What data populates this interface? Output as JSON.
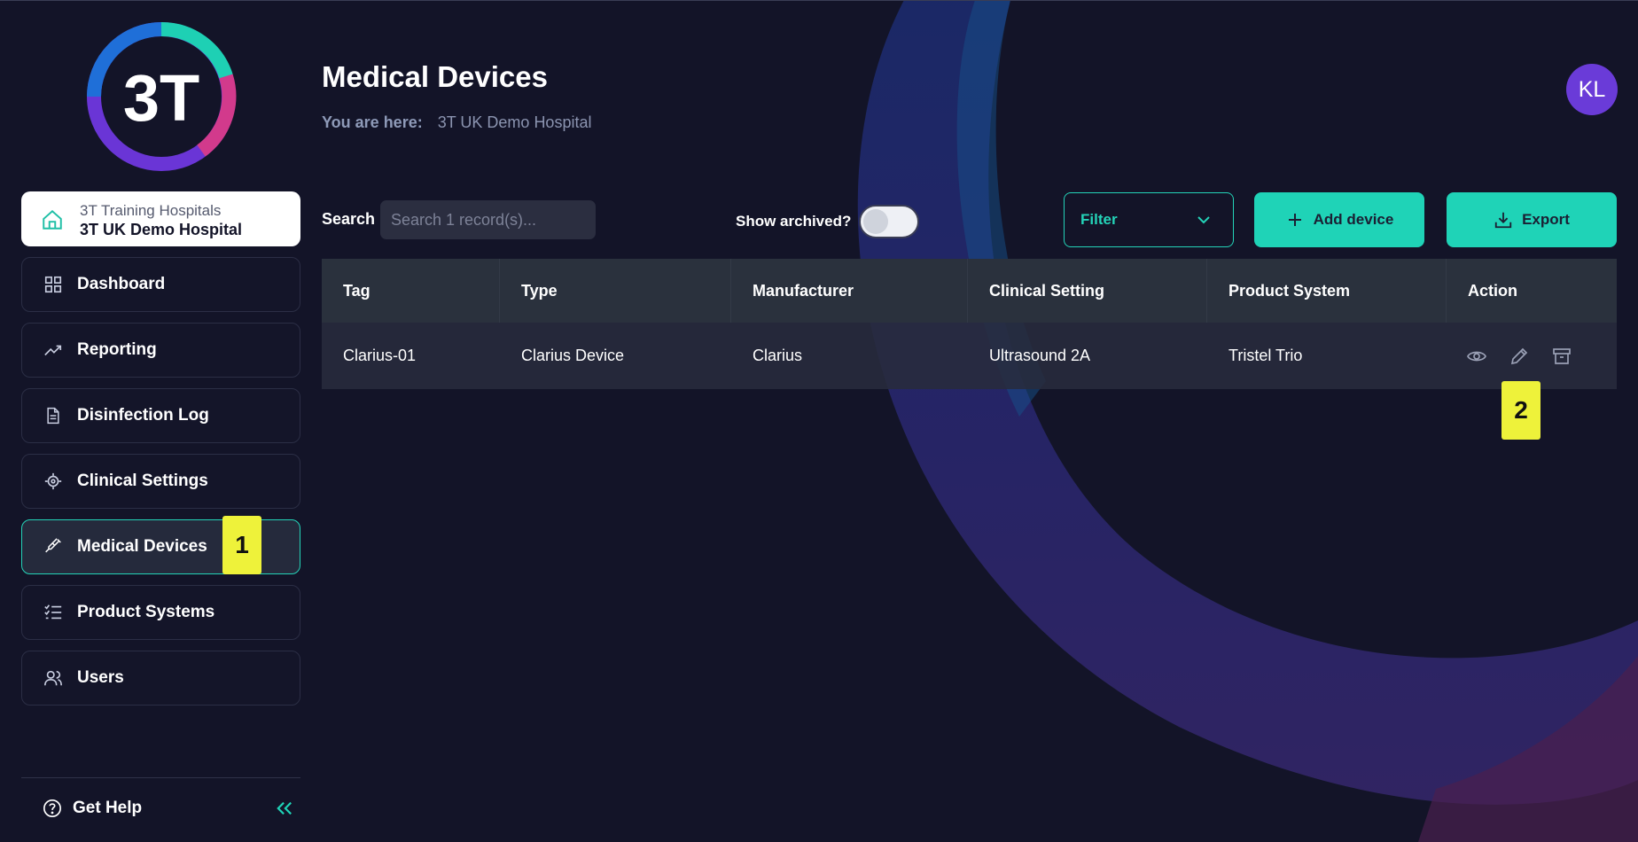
{
  "brand": {
    "logo_text": "3T"
  },
  "sidebar": {
    "hospital": {
      "org": "3T Training Hospitals",
      "site": "3T UK Demo Hospital"
    },
    "items": [
      {
        "label": "Dashboard",
        "icon": "grid-icon"
      },
      {
        "label": "Reporting",
        "icon": "trend-icon"
      },
      {
        "label": "Disinfection Log",
        "icon": "document-icon"
      },
      {
        "label": "Clinical Settings",
        "icon": "target-icon"
      },
      {
        "label": "Medical Devices",
        "icon": "syringe-icon",
        "active": true
      },
      {
        "label": "Product Systems",
        "icon": "checklist-icon"
      },
      {
        "label": "Users",
        "icon": "users-icon"
      }
    ],
    "help_label": "Get Help"
  },
  "header": {
    "title": "Medical Devices",
    "breadcrumb_label": "You are here:",
    "breadcrumb_value": "3T UK Demo Hospital",
    "avatar_initials": "KL"
  },
  "toolbar": {
    "search_label": "Search",
    "search_placeholder": "Search 1 record(s)...",
    "show_archived_label": "Show archived?",
    "show_archived": false,
    "filter_label": "Filter",
    "add_label": "Add device",
    "export_label": "Export"
  },
  "table": {
    "headers": [
      "Tag",
      "Type",
      "Manufacturer",
      "Clinical Setting",
      "Product System",
      "Action"
    ],
    "rows": [
      [
        "Clarius-01",
        "Clarius Device",
        "Clarius",
        "Ultrasound 2A",
        "Tristel Trio"
      ]
    ],
    "row_actions": [
      "view-icon",
      "edit-icon",
      "archive-icon"
    ]
  },
  "annotations": {
    "marker_1": "1",
    "marker_2": "2"
  },
  "colors": {
    "accent": "#1fd3b7",
    "background": "#131428",
    "avatar": "#6a3bd8",
    "marker": "#eef23a"
  }
}
